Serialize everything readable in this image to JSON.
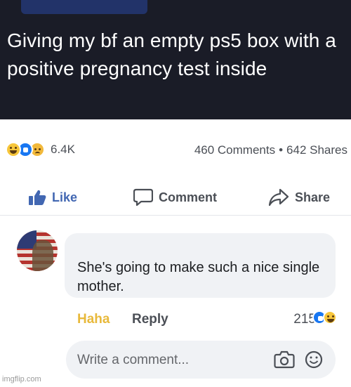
{
  "post": {
    "text": "Giving my bf an empty ps5 box with a positive pregnancy test inside"
  },
  "stats": {
    "reaction_icons": [
      "haha-icon",
      "like-icon",
      "sad-icon"
    ],
    "reaction_count": "6.4K",
    "comments": "460 Comments",
    "separator": "•",
    "shares": "642 Shares"
  },
  "actions": {
    "like": "Like",
    "comment": "Comment",
    "share": "Share"
  },
  "comment": {
    "text": "She's going to make such a nice single mother.",
    "reaction_label": "Haha",
    "reply_label": "Reply",
    "reaction_count": "215",
    "reaction_icons": [
      "like-icon",
      "haha-icon"
    ]
  },
  "composer": {
    "placeholder": "Write a comment..."
  },
  "watermark": "imgflip.com",
  "colors": {
    "header_bg": "#1a1c27",
    "like_blue": "#4267b2",
    "haha_yellow": "#e8b93b",
    "bubble_bg": "#f0f2f5"
  }
}
